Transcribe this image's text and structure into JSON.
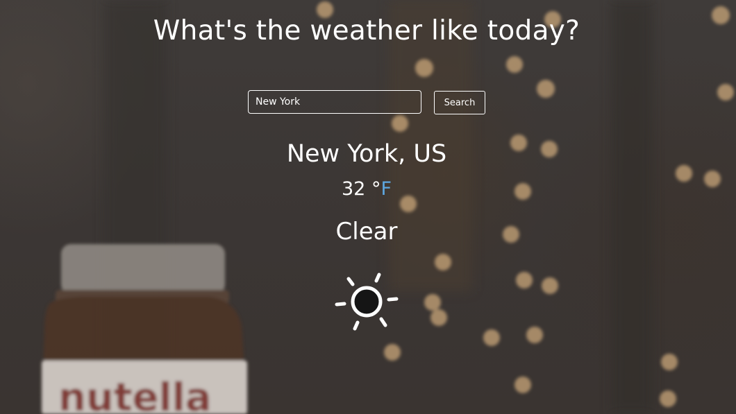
{
  "header": {
    "title": "What's the weather like today?"
  },
  "search": {
    "value": "New York",
    "button_label": "Search"
  },
  "weather": {
    "location": "New York, US",
    "temperature": "32",
    "degree_symbol": "°",
    "unit": "F",
    "condition": "Clear",
    "icon": "sun-icon"
  },
  "colors": {
    "background": "#403b38",
    "text": "#ffffff",
    "unit_link": "#5ea7e0"
  },
  "background_photo": {
    "jar_label_text": "nutella"
  }
}
